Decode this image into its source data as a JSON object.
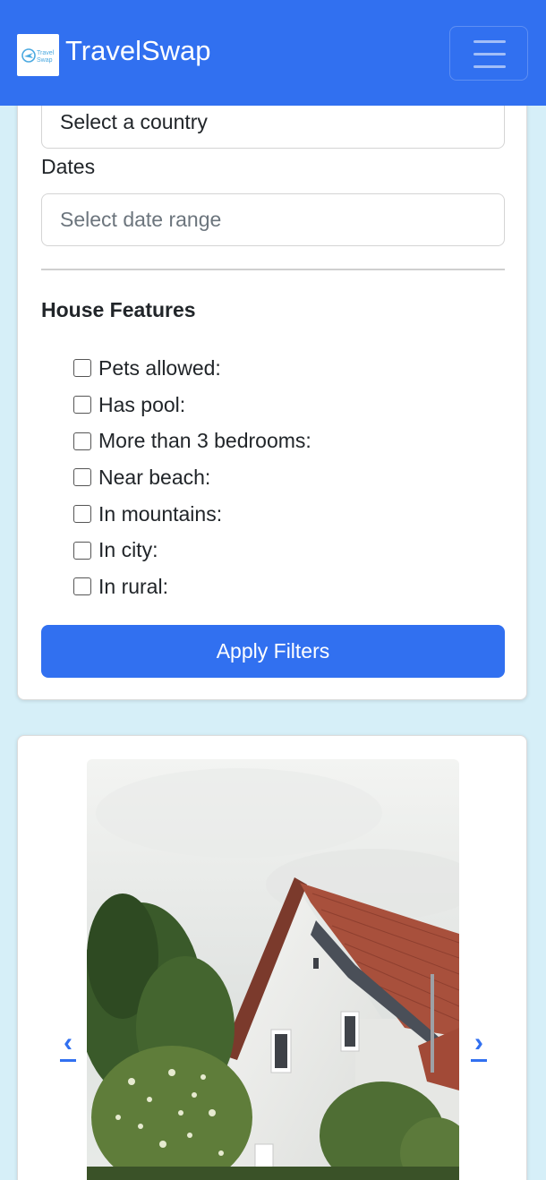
{
  "navbar": {
    "brand": "TravelSwap",
    "logo_text_line1": "Travel",
    "logo_text_line2": "Swap",
    "menu_icon": "hamburger-icon",
    "bg_color": "#3170f0"
  },
  "filters": {
    "country_select_value": "Select a country",
    "dates_label": "Dates",
    "dates_placeholder": "Select date range",
    "house_features_title": "House Features",
    "features": [
      {
        "label": "Pets allowed:",
        "checked": false
      },
      {
        "label": "Has pool:",
        "checked": false
      },
      {
        "label": "More than 3 bedrooms:",
        "checked": false
      },
      {
        "label": "Near beach:",
        "checked": false
      },
      {
        "label": "In mountains:",
        "checked": false
      },
      {
        "label": "In city:",
        "checked": false
      },
      {
        "label": "In rural:",
        "checked": false
      }
    ],
    "apply_button": "Apply Filters"
  },
  "listing": {
    "prev_icon": "chevron-left-icon",
    "next_icon": "chevron-right-icon",
    "prev_glyph": "‹",
    "next_glyph": "›"
  }
}
